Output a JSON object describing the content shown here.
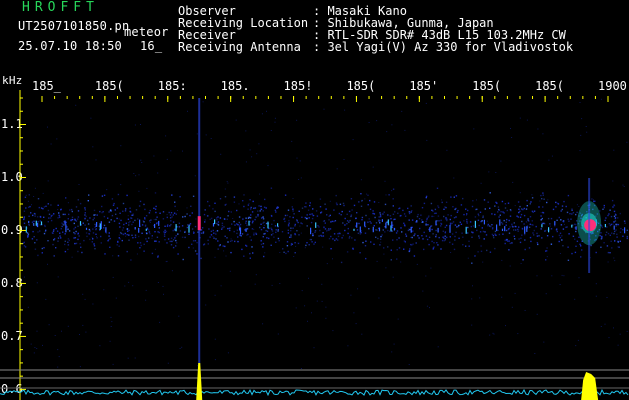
{
  "header": {
    "app_title": "HROFFT",
    "file_name": "UT2507101850.pn",
    "mode_label": "meteor",
    "date_time": "25.07.10 18:50",
    "minute_label": "16_"
  },
  "info": [
    {
      "label": "Observer",
      "value": ": Masaki Kano"
    },
    {
      "label": "Receiving Location",
      "value": ": Shibukawa, Gunma, Japan"
    },
    {
      "label": "Receiver",
      "value": ": RTL-SDR SDR# 43dB L15 103.2MHz CW"
    },
    {
      "label": "Receiving Antenna",
      "value": ": 3el Yagi(V) Az 330 for Vladivostok"
    }
  ],
  "chart_data": {
    "type": "heatmap",
    "ylabel": "kHz",
    "time_ticks": [
      "185_",
      "185(",
      "185:",
      "185.",
      "185!",
      "185(",
      "185'",
      "185(",
      "185(",
      "1900"
    ],
    "y_ticks": [
      1.1,
      1.0,
      0.9,
      0.8,
      0.7,
      0.6
    ],
    "ylim": [
      0.58,
      1.15
    ],
    "carrier_frequency_khz": 0.91,
    "meteor_echoes": [
      {
        "minute_index": 2.5,
        "frequency_khz": 0.91,
        "duration": "short"
      },
      {
        "minute_index": 8.7,
        "frequency_khz": 0.91,
        "duration": "long"
      }
    ],
    "colors": {
      "noise": "#1a2fd0",
      "echo_core": "#ff2f7a",
      "echo_halo": "#20e0d8",
      "ticks": "#ffff00",
      "signal_trace": "#22c8f0",
      "signal_peak": "#ffff00"
    }
  }
}
